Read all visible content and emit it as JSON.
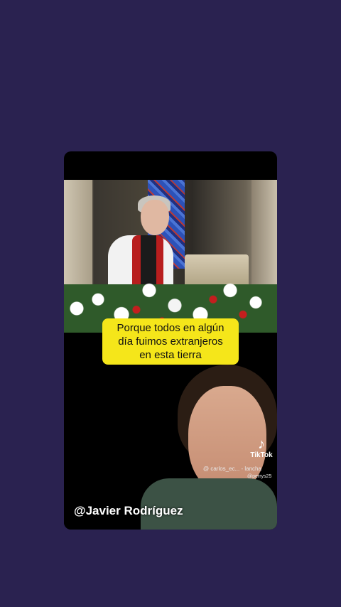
{
  "caption": {
    "line1": "Porque todos en algún",
    "line2": "día fuimos extranjeros",
    "line3": "en esta tierra"
  },
  "watermark": {
    "brand": "TikTok",
    "handle_primary": "@ carlos_ec... - lancha",
    "handle_secondary": "@perrys25"
  },
  "creator_handle": "@Javier Rodríguez",
  "colors": {
    "background": "#2a2250",
    "caption_bg": "#f5e61a",
    "card_bg": "#000000"
  }
}
